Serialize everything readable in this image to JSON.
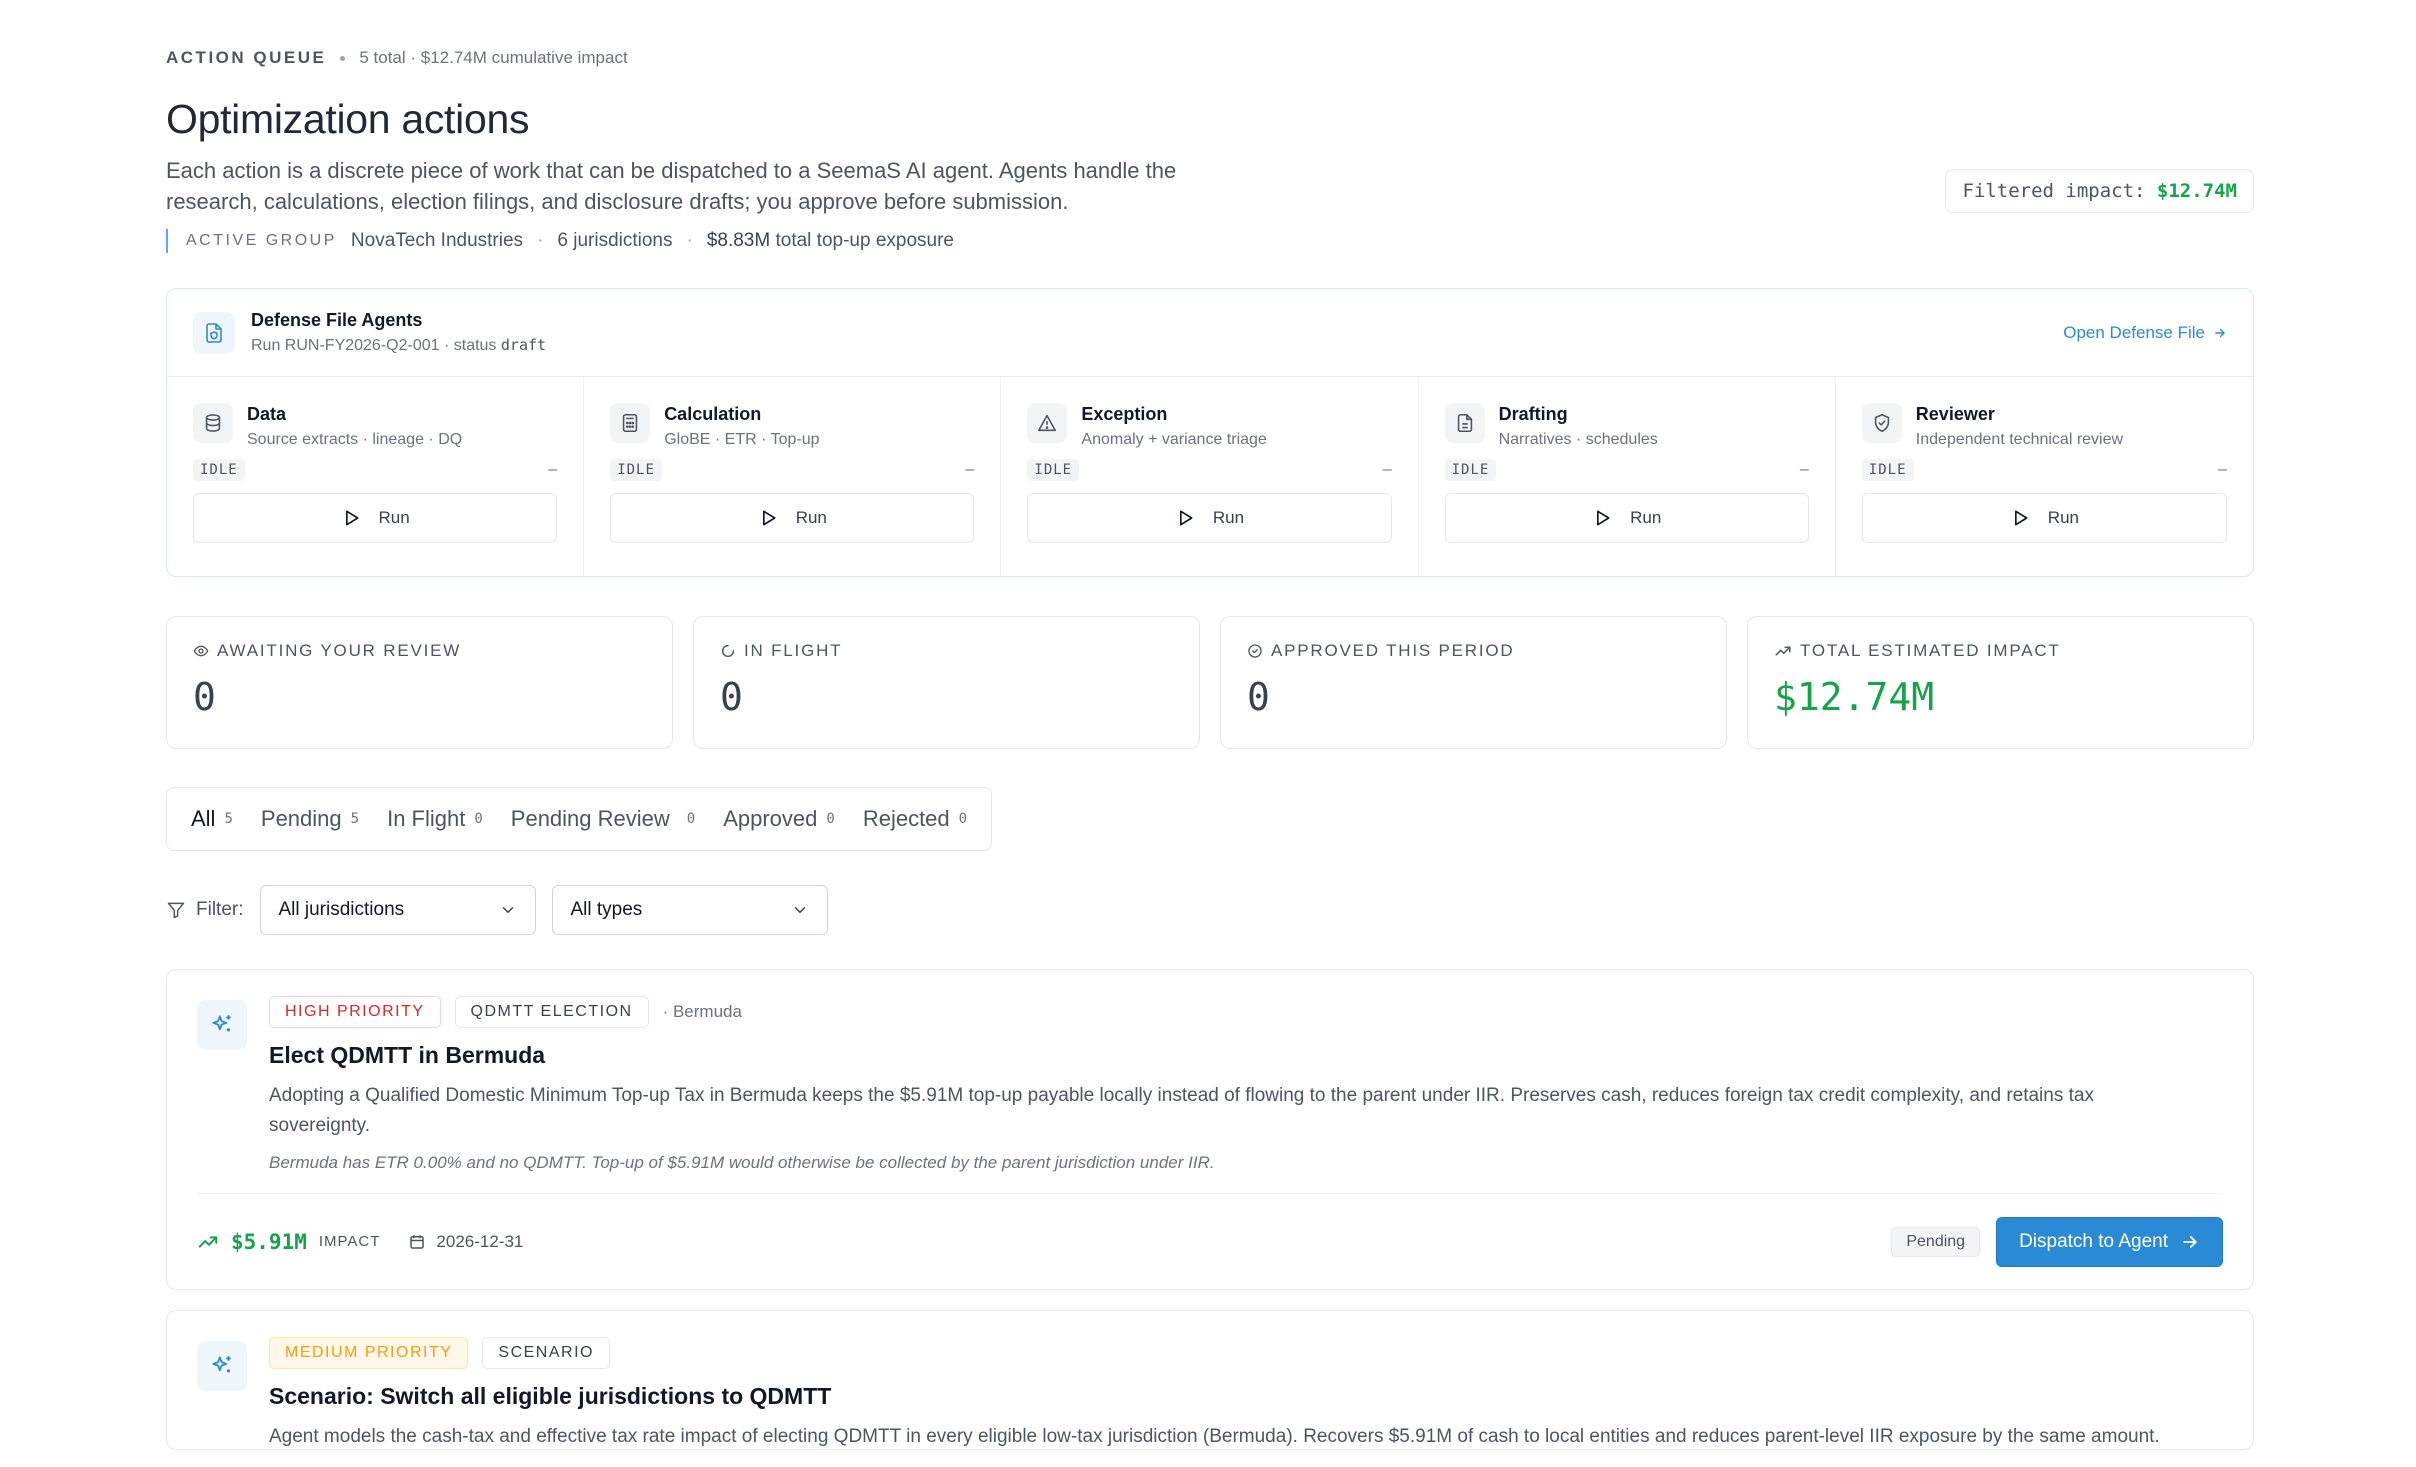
{
  "header": {
    "eyebrow_label": "ACTION QUEUE",
    "eyebrow_meta": "5 total · $12.74M cumulative impact",
    "title": "Optimization actions",
    "description": "Each action is a discrete piece of work that can be dispatched to a SeemaS AI agent. Agents handle the research, calculations, election filings, and disclosure drafts; you approve before submission.",
    "filtered_impact_label": "Filtered impact:",
    "filtered_impact_value": "$12.74M"
  },
  "active_group": {
    "label": "ACTIVE GROUP",
    "name": "NovaTech Industries",
    "jurisdictions": "6 jurisdictions",
    "exposure_value": "$8.83M",
    "exposure_label": "total top-up exposure"
  },
  "defense_file": {
    "title": "Defense File Agents",
    "run_prefix": "Run RUN-FY2026-Q2-001 · status",
    "status": "draft",
    "open_link": "Open Defense File"
  },
  "agents": [
    {
      "name": "Data",
      "desc": "Source extracts · lineage · DQ",
      "status": "IDLE",
      "last": "–",
      "run_label": "Run",
      "icon": "database-icon"
    },
    {
      "name": "Calculation",
      "desc": "GloBE · ETR · Top-up",
      "status": "IDLE",
      "last": "–",
      "run_label": "Run",
      "icon": "calculator-icon"
    },
    {
      "name": "Exception",
      "desc": "Anomaly + variance triage",
      "status": "IDLE",
      "last": "–",
      "run_label": "Run",
      "icon": "warning-triangle-icon"
    },
    {
      "name": "Drafting",
      "desc": "Narratives · schedules",
      "status": "IDLE",
      "last": "–",
      "run_label": "Run",
      "icon": "document-icon"
    },
    {
      "name": "Reviewer",
      "desc": "Independent technical review",
      "status": "IDLE",
      "last": "–",
      "run_label": "Run",
      "icon": "shield-check-icon"
    }
  ],
  "stats": [
    {
      "label": "AWAITING YOUR REVIEW",
      "value": "0",
      "icon": "eye-icon"
    },
    {
      "label": "IN FLIGHT",
      "value": "0",
      "icon": "loader-icon"
    },
    {
      "label": "APPROVED THIS PERIOD",
      "value": "0",
      "icon": "check-circle-icon"
    },
    {
      "label": "TOTAL ESTIMATED IMPACT",
      "value": "$12.74M",
      "icon": "trending-up-icon"
    }
  ],
  "tabs": [
    {
      "label": "All",
      "count": "5"
    },
    {
      "label": "Pending",
      "count": "5"
    },
    {
      "label": "In Flight",
      "count": "0"
    },
    {
      "label": "Pending Review",
      "count": "0"
    },
    {
      "label": "Approved",
      "count": "0"
    },
    {
      "label": "Rejected",
      "count": "0"
    }
  ],
  "filters": {
    "label": "Filter:",
    "jurisdiction": "All jurisdictions",
    "type": "All types"
  },
  "actions": [
    {
      "priority": "HIGH PRIORITY",
      "type": "QDMTT ELECTION",
      "location": "· Bermuda",
      "title": "Elect QDMTT in Bermuda",
      "description": "Adopting a Qualified Domestic Minimum Top-up Tax in Bermuda keeps the $5.91M top-up payable locally instead of flowing to the parent under IIR. Preserves cash, reduces foreign tax credit complexity, and retains tax sovereignty.",
      "note": "Bermuda has ETR 0.00% and no QDMTT. Top-up of $5.91M would otherwise be collected by the parent jurisdiction under IIR.",
      "impact": "$5.91M",
      "impact_label": "IMPACT",
      "due": "2026-12-31",
      "status": "Pending",
      "dispatch_label": "Dispatch to Agent"
    },
    {
      "priority": "MEDIUM PRIORITY",
      "type": "SCENARIO",
      "title": "Scenario: Switch all eligible jurisdictions to QDMTT",
      "description": "Agent models the cash-tax and effective tax rate impact of electing QDMTT in every eligible low-tax jurisdiction (Bermuda). Recovers $5.91M of cash to local entities and reduces parent-level IIR exposure by the same amount."
    }
  ],
  "colors": {
    "accent": "#2b8ad6",
    "positive": "#16a34a",
    "high_priority": "#dc2626",
    "medium_priority": "#f59e0b"
  }
}
